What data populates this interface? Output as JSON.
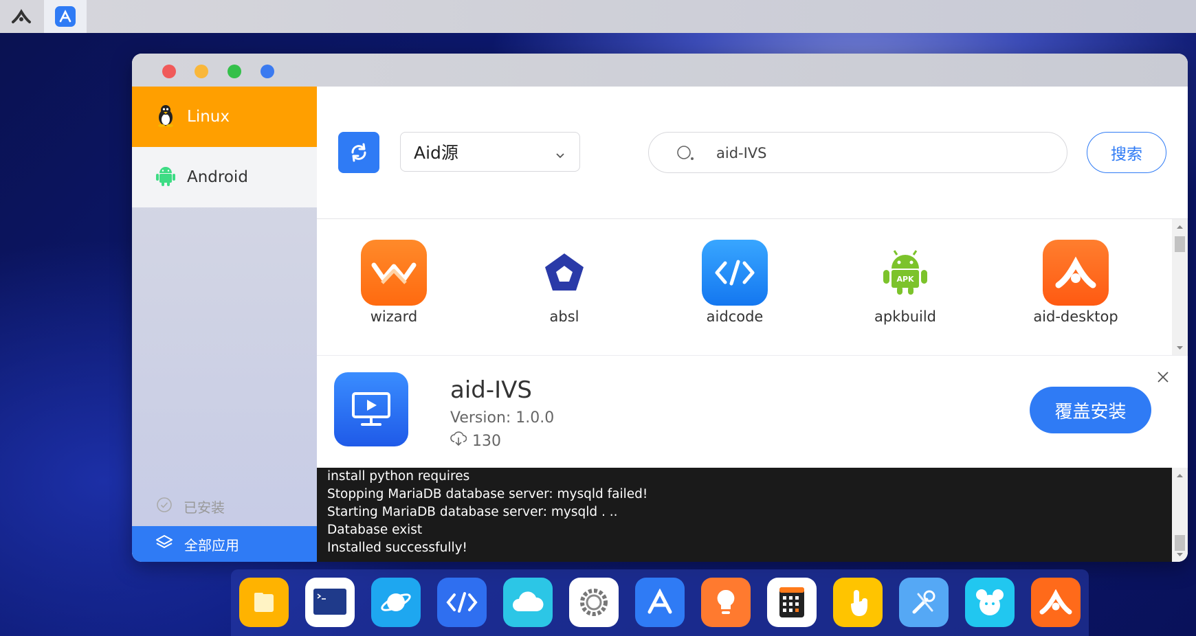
{
  "topbar": {
    "items": [
      {
        "name": "aidlux-logo-icon"
      },
      {
        "name": "app-store-icon",
        "active": true
      }
    ]
  },
  "window": {
    "traffic_lights": [
      "#f05a5a",
      "#f9b73a",
      "#34c04a",
      "#3a7af0"
    ]
  },
  "sidebar": {
    "items": [
      {
        "label": "Linux",
        "icon": "penguin-icon",
        "active": true
      },
      {
        "label": "Android",
        "icon": "android-icon",
        "active": false
      }
    ],
    "installed_label": "已安装",
    "all_apps_label": "全部应用"
  },
  "toolbar": {
    "source_select": "Aid源",
    "search_value": "aid-IVS",
    "search_button": "搜索"
  },
  "apps": [
    {
      "name": "wizard",
      "icon": "wizard-icon"
    },
    {
      "name": "absl",
      "icon": "pentagon-icon"
    },
    {
      "name": "aidcode",
      "icon": "code-icon"
    },
    {
      "name": "apkbuild",
      "icon": "apk-android-icon"
    },
    {
      "name": "aid-desktop",
      "icon": "aid-desktop-icon"
    }
  ],
  "detail": {
    "name": "aid-IVS",
    "version": "Version: 1.0.0",
    "downloads": "130",
    "install_button": "覆盖安装"
  },
  "console": {
    "lines": [
      "install python requires",
      "Stopping MariaDB database server: mysqld failed!",
      "Starting MariaDB database server: mysqld . ..",
      "Database exist",
      "Installed successfully!"
    ]
  },
  "dock": [
    {
      "name": "files-icon",
      "color": "#ffb300"
    },
    {
      "name": "terminal-icon",
      "color": "#ffffff"
    },
    {
      "name": "browser-icon",
      "color": "#1ea7f0"
    },
    {
      "name": "code-editor-icon",
      "color": "#2f6ff0"
    },
    {
      "name": "cloud-icon",
      "color": "#2cc6e6"
    },
    {
      "name": "settings-icon",
      "color": "#ffffff"
    },
    {
      "name": "app-store-icon",
      "color": "#2f7bf5"
    },
    {
      "name": "idea-icon",
      "color": "#ff7a2f"
    },
    {
      "name": "calculator-icon",
      "color": "#ffffff"
    },
    {
      "name": "touch-icon",
      "color": "#ffc400"
    },
    {
      "name": "tools-icon",
      "color": "#55a8f5"
    },
    {
      "name": "mouse-icon",
      "color": "#21c7f0"
    },
    {
      "name": "aid-desktop-icon",
      "color": "#ff6a1a"
    }
  ]
}
